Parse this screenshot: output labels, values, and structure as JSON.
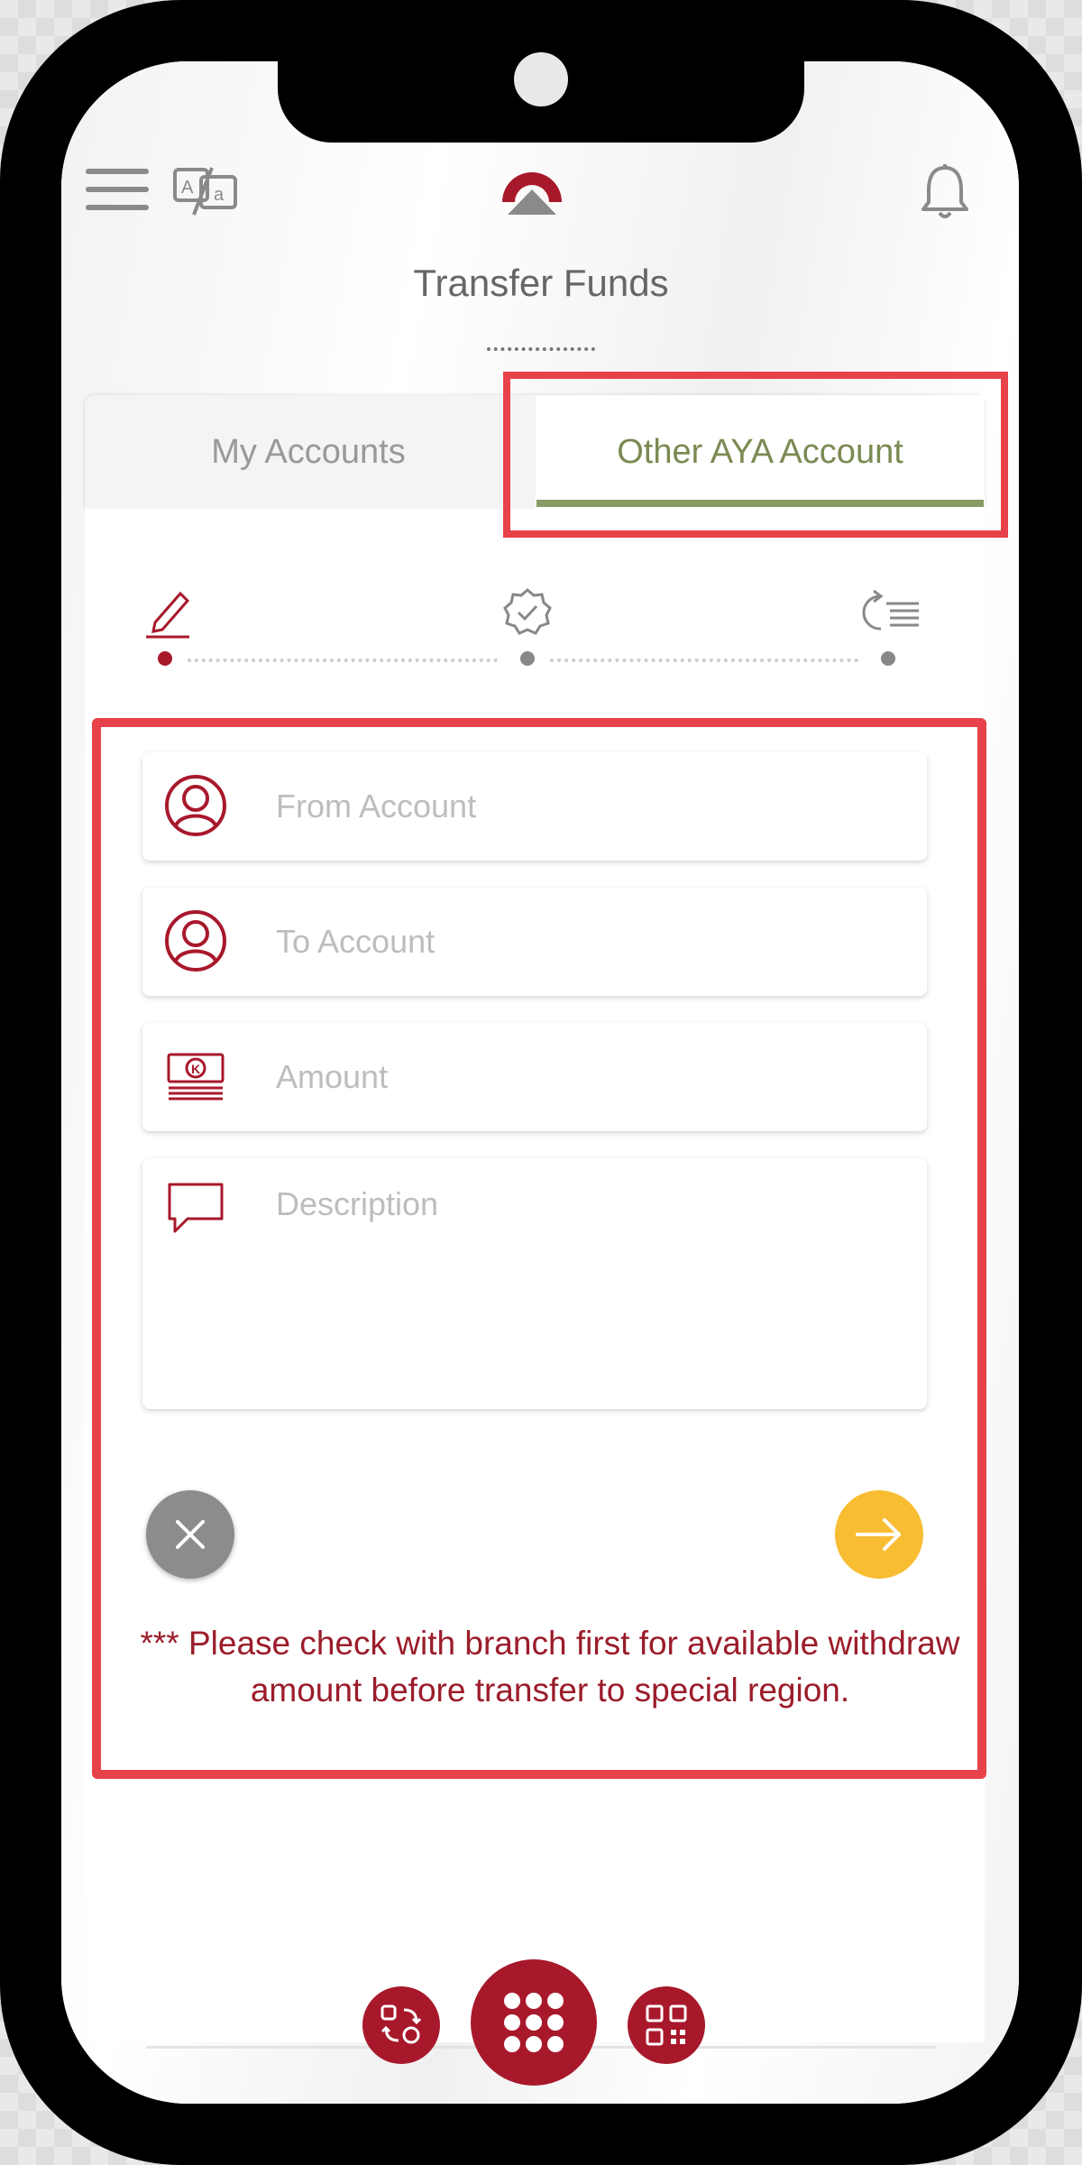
{
  "header": {
    "title": "Transfer Funds",
    "menu_icon": "hamburger-icon",
    "language_icon": "translate-icon",
    "logo_icon": "aya-logo",
    "notification_icon": "bell-icon"
  },
  "tabs": [
    {
      "label": "My Accounts",
      "active": false
    },
    {
      "label": "Other AYA Account",
      "active": true
    }
  ],
  "steps": [
    {
      "icon": "edit-pencil-icon",
      "state": "current"
    },
    {
      "icon": "verified-badge-icon",
      "state": "pending"
    },
    {
      "icon": "transfer-list-icon",
      "state": "pending"
    }
  ],
  "form": {
    "from_account_placeholder": "From Account",
    "to_account_placeholder": "To Account",
    "amount_placeholder": "Amount",
    "description_placeholder": "Description"
  },
  "actions": {
    "cancel_icon": "close-icon",
    "next_icon": "arrow-right-icon"
  },
  "notice": "*** Please check with branch first for available withdraw amount before transfer to special region.",
  "bottom_nav": [
    {
      "icon": "exchange-icon"
    },
    {
      "icon": "apps-grid-icon"
    },
    {
      "icon": "qr-code-icon"
    }
  ],
  "colors": {
    "brand_red": "#a8182b",
    "active_tab": "#7a8a52",
    "next_button": "#f8bd33",
    "highlight": "#e7424a"
  }
}
